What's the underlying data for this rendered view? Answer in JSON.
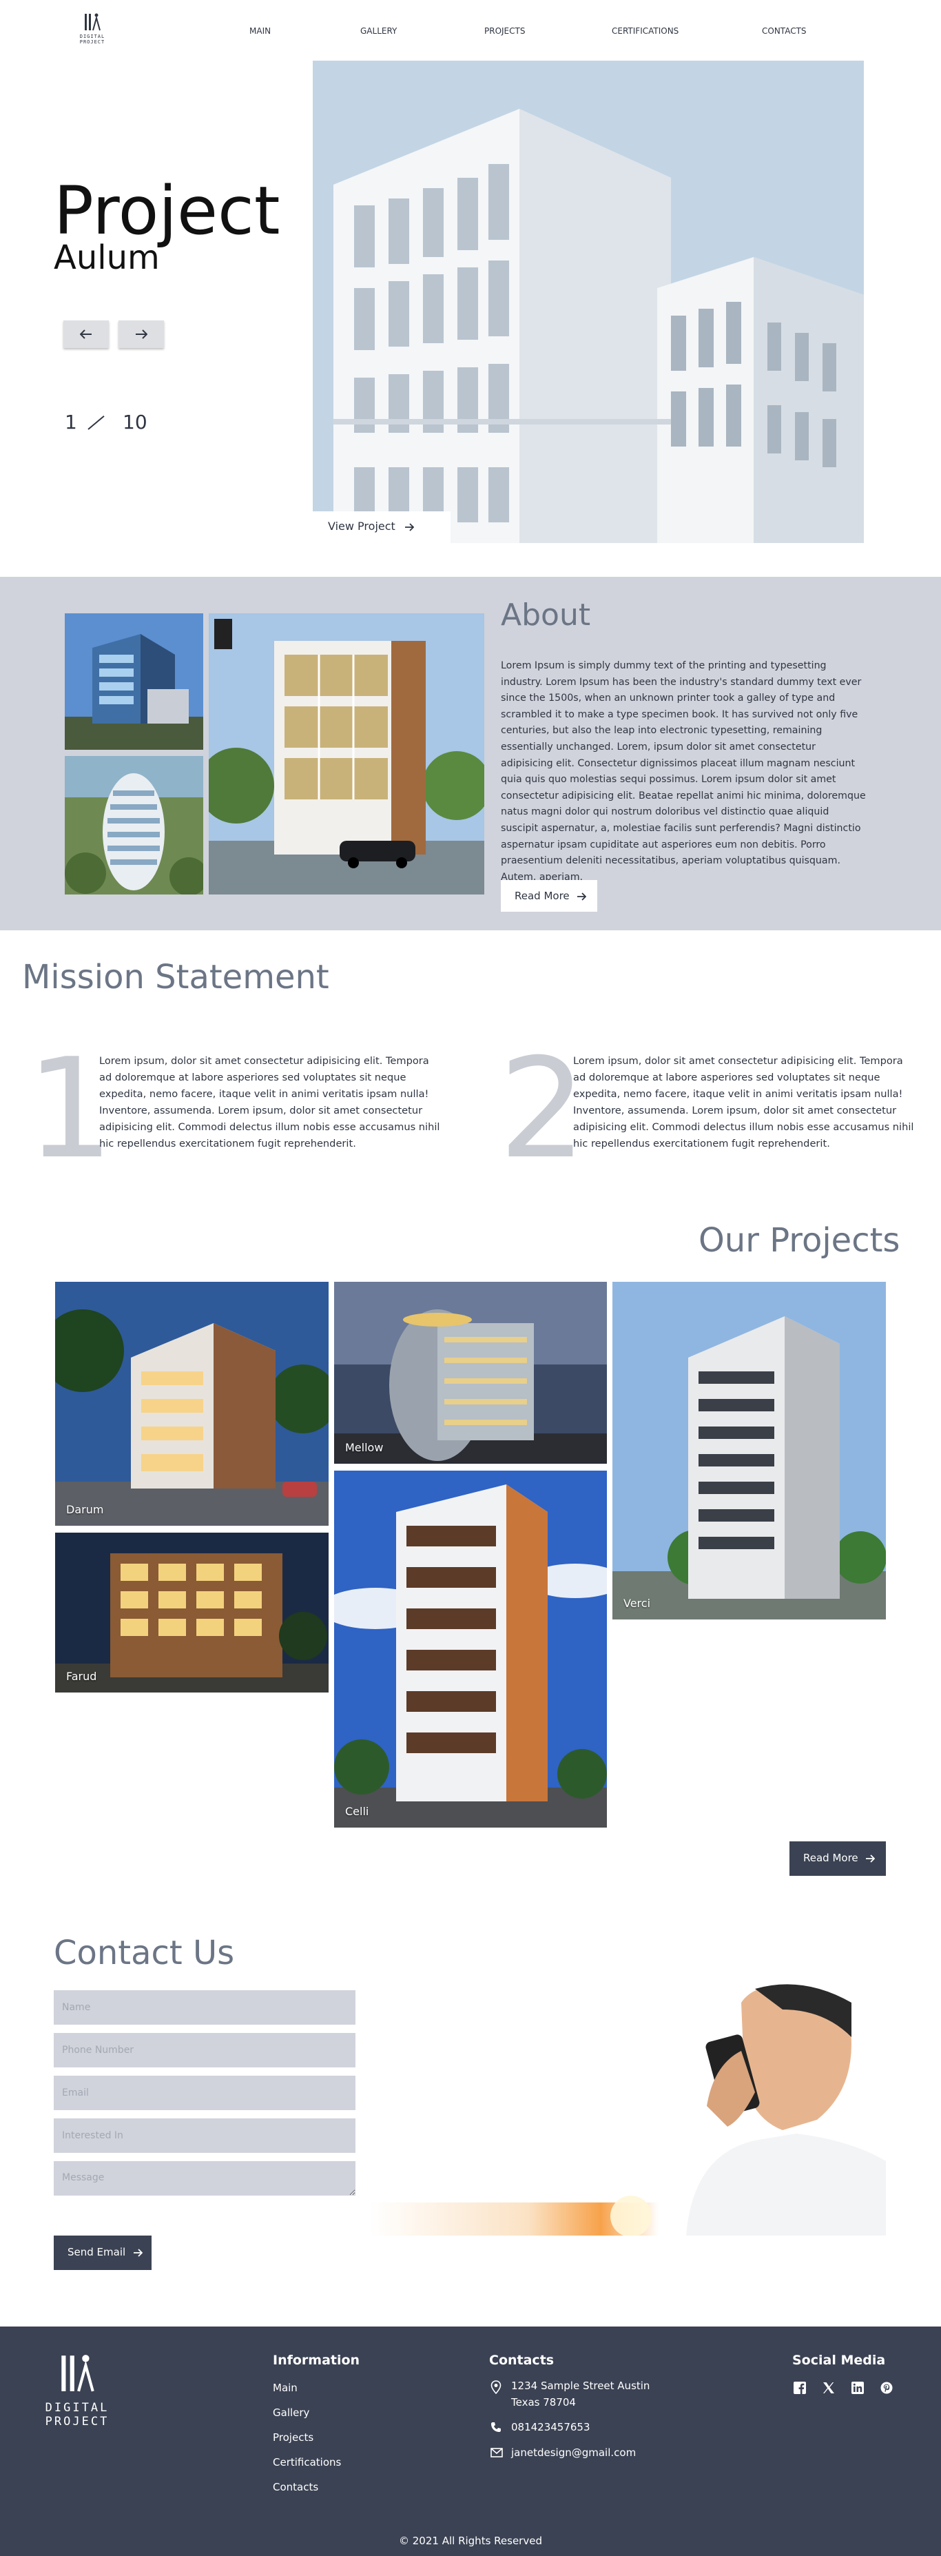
{
  "brand": {
    "logo_text": "DIGITAL PROJECT"
  },
  "nav": {
    "items": [
      "MAIN",
      "GALLERY",
      "PROJECTS",
      "CERTIFICATIONS",
      "CONTACTS"
    ]
  },
  "hero": {
    "title": "Project",
    "subtitle": "Aulum",
    "slide_current": "1",
    "slide_total": "10",
    "view_project_label": "View Project"
  },
  "about": {
    "title": "About",
    "text": "Lorem Ipsum is simply dummy text of the printing and typesetting industry. Lorem Ipsum has been the industry's standard dummy text ever since the 1500s, when an unknown printer took a galley of type and scrambled it to make a type specimen book. It has survived not only five centuries, but also the leap into electronic typesetting, remaining essentially unchanged. Lorem, ipsum dolor sit amet consectetur adipisicing elit. Consectetur dignissimos placeat illum magnam nesciunt quia quis quo molestias sequi possimus. Lorem ipsum dolor sit amet consectetur adipisicing elit. Beatae repellat animi hic minima, doloremque natus magni dolor qui nostrum doloribus vel distinctio quae aliquid suscipit aspernatur, a, molestiae facilis sunt perferendis? Magni distinctio aspernatur ipsam cupiditate aut asperiores eum non debitis. Porro praesentium deleniti necessitatibus, aperiam voluptatibus quisquam. Autem, aperiam.",
    "read_more_label": "Read More"
  },
  "mission": {
    "title": "Mission Statement",
    "items": [
      {
        "number": "1",
        "text": "Lorem ipsum, dolor sit amet consectetur adipisicing elit. Tempora ad doloremque at labore asperiores sed voluptates sit neque expedita, nemo facere, itaque velit in animi veritatis ipsam nulla! Inventore, assumenda. Lorem ipsum, dolor sit amet consectetur adipisicing elit. Commodi delectus illum nobis esse accusamus nihil hic repellendus exercitationem fugit reprehenderit."
      },
      {
        "number": "2",
        "text": "Lorem ipsum, dolor sit amet consectetur adipisicing elit. Tempora ad doloremque at labore asperiores sed voluptates sit neque expedita, nemo facere, itaque velit in animi veritatis ipsam nulla! Inventore, assumenda. Lorem ipsum, dolor sit amet consectetur adipisicing elit. Commodi delectus illum nobis esse accusamus nihil hic repellendus exercitationem fugit reprehenderit."
      }
    ]
  },
  "projects": {
    "title": "Our Projects",
    "items": [
      "Darum",
      "Mellow",
      "Verci",
      "Farud",
      "Celli"
    ],
    "read_more_label": "Read More"
  },
  "contact": {
    "title": "Contact Us",
    "placeholders": [
      "Name",
      "Phone Number",
      "Email",
      "Interested In",
      "Message"
    ],
    "send_label": "Send Email"
  },
  "footer": {
    "logo_text": "DIGITAL PROJECT",
    "info_heading": "Information",
    "info_links": [
      "Main",
      "Gallery",
      "Projects",
      "Certifications",
      "Contacts"
    ],
    "contacts_heading": "Contacts",
    "address_line1": "1234 Sample Street Austin",
    "address_line2": "Texas 78704",
    "phone": "081423457653",
    "email": "janetdesign@gmail.com",
    "social_heading": "Social Media",
    "social_icons": [
      "facebook-icon",
      "x-twitter-icon",
      "linkedin-icon",
      "pinterest-icon"
    ],
    "copyright": "© 2021 All Rights Reserved"
  },
  "colors": {
    "dark": "#3b4253",
    "light_gray": "#d0d3db",
    "heading_gray": "#6b7585",
    "text": "#2f3542"
  }
}
